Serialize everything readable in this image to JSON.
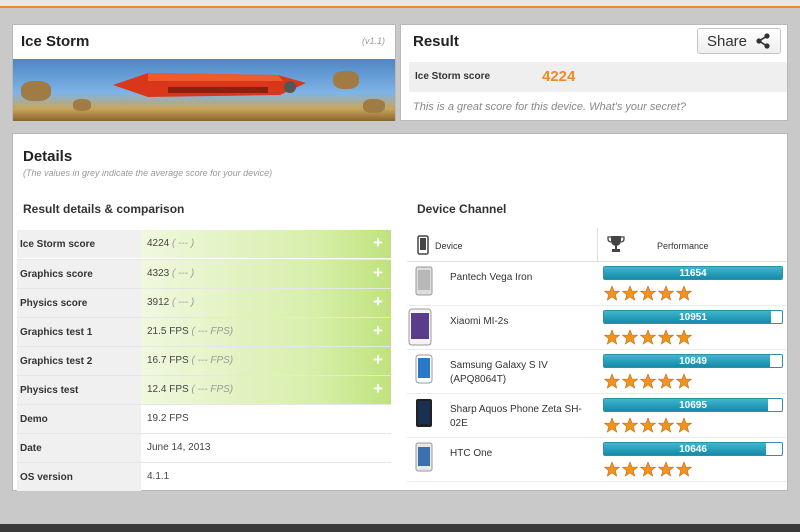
{
  "test": {
    "title": "Ice Storm",
    "version": "(v1.1)"
  },
  "result": {
    "title": "Result",
    "share_label": "Share",
    "score_label": "Ice Storm score",
    "score_value": "4224",
    "message": "This is a great score for this device. What's your secret?"
  },
  "details": {
    "title": "Details",
    "subtitle": "(The values in grey indicate the average score for your device)",
    "left_title": "Result details & comparison",
    "right_title": "Device Channel",
    "rows": [
      {
        "label": "Ice Storm score",
        "value": "4224",
        "avg": "( --- )",
        "expandable": true
      },
      {
        "label": "Graphics score",
        "value": "4323",
        "avg": "( --- )",
        "expandable": true
      },
      {
        "label": "Physics score",
        "value": "3912",
        "avg": "( --- )",
        "expandable": true
      },
      {
        "label": "Graphics test 1",
        "value": "21.5 FPS",
        "avg": "( --- FPS)",
        "expandable": true
      },
      {
        "label": "Graphics test 2",
        "value": "16.7 FPS",
        "avg": "( --- FPS)",
        "expandable": true
      },
      {
        "label": "Physics test",
        "value": "12.4 FPS",
        "avg": "( --- FPS)",
        "expandable": true
      },
      {
        "label": "Demo",
        "value": "19.2 FPS",
        "avg": "",
        "expandable": false
      },
      {
        "label": "Date",
        "value": "June 14, 2013",
        "avg": "",
        "expandable": false
      },
      {
        "label": "OS version",
        "value": "4.1.1",
        "avg": "",
        "expandable": false
      }
    ],
    "device_header": "Device",
    "performance_header": "Performance",
    "devices": [
      {
        "name": "Pantech Vega Iron",
        "score": "11654",
        "fill": 1.0,
        "stars": 5
      },
      {
        "name": "Xiaomi MI-2s",
        "score": "10951",
        "fill": 0.94,
        "stars": 5
      },
      {
        "name": "Samsung Galaxy S IV (APQ8064T)",
        "score": "10849",
        "fill": 0.93,
        "stars": 5
      },
      {
        "name": "Sharp Aquos Phone Zeta SH-02E",
        "score": "10695",
        "fill": 0.92,
        "stars": 5
      },
      {
        "name": "HTC One",
        "score": "10646",
        "fill": 0.91,
        "stars": 5
      }
    ]
  },
  "colors": {
    "accent": "#f08a24",
    "bar": "#1d93b0",
    "star": "#f0941e"
  },
  "icons": [
    "share-icon",
    "plus-icon",
    "phone-icon",
    "trophy-icon",
    "star-icon",
    "device-thumbnail"
  ]
}
